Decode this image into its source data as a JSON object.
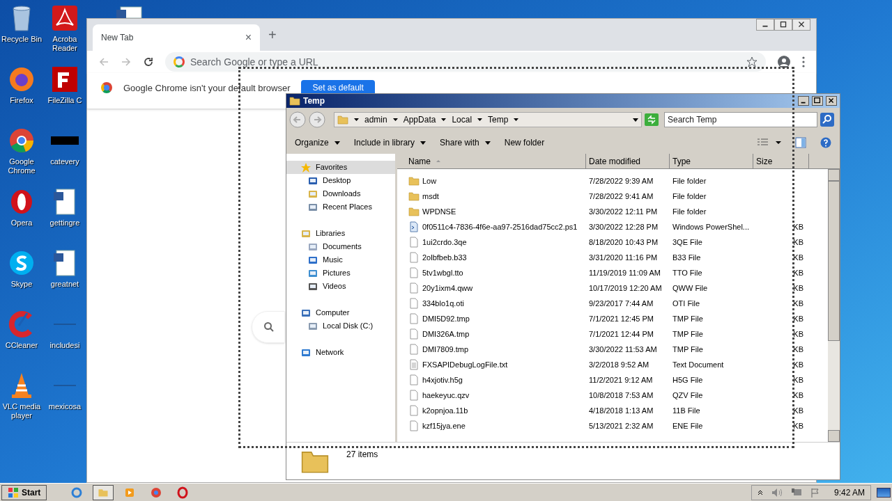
{
  "desktop": {
    "icons": [
      {
        "label": "Recycle Bin"
      },
      {
        "label": "Acroba Reader"
      },
      {
        "label": "Firefox"
      },
      {
        "label": "FileZilla C"
      },
      {
        "label": "Google Chrome"
      },
      {
        "label": "catevery"
      },
      {
        "label": "Opera"
      },
      {
        "label": "gettingre"
      },
      {
        "label": "Skype"
      },
      {
        "label": "greatnet"
      },
      {
        "label": "CCleaner"
      },
      {
        "label": "includesi"
      },
      {
        "label": "VLC media player"
      },
      {
        "label": "mexicosa"
      }
    ]
  },
  "chrome": {
    "tab": {
      "title": "New Tab",
      "close": "×"
    },
    "new_tab": "+",
    "address": {
      "placeholder": "Search Google or type a URL"
    },
    "infobar": {
      "message": "Google Chrome isn't your default browser",
      "button": "Set as default"
    }
  },
  "explorer": {
    "title": "Temp",
    "breadcrumb": [
      "admin",
      "AppData",
      "Local",
      "Temp"
    ],
    "search": {
      "placeholder": "Search Temp"
    },
    "toolbar": [
      {
        "label": "Organize",
        "menu": true
      },
      {
        "label": "Include in library",
        "menu": true
      },
      {
        "label": "Share with",
        "menu": true
      },
      {
        "label": "New folder",
        "menu": false
      }
    ],
    "nav": [
      {
        "label": "Favorites",
        "kind": "star",
        "selected": true,
        "children": [
          {
            "label": "Desktop",
            "kind": "desktop",
            "selected": false
          },
          {
            "label": "Downloads",
            "kind": "downloads",
            "selected": false
          },
          {
            "label": "Recent Places",
            "kind": "recent",
            "selected": false
          }
        ]
      },
      {
        "label": "Libraries",
        "kind": "libraries",
        "selected": false,
        "children": [
          {
            "label": "Documents",
            "kind": "documents",
            "selected": false
          },
          {
            "label": "Music",
            "kind": "music",
            "selected": false
          },
          {
            "label": "Pictures",
            "kind": "pictures",
            "selected": false
          },
          {
            "label": "Videos",
            "kind": "videos",
            "selected": false
          }
        ]
      },
      {
        "label": "Computer",
        "kind": "computer",
        "selected": false,
        "children": [
          {
            "label": "Local Disk (C:)",
            "kind": "disk",
            "selected": false
          }
        ]
      },
      {
        "label": "Network",
        "kind": "network",
        "selected": false
      }
    ],
    "columns": [
      {
        "label": "Name",
        "sorted": true
      },
      {
        "label": "Date modified",
        "sorted": false
      },
      {
        "label": "Type",
        "sorted": false
      },
      {
        "label": "Size",
        "sorted": false
      }
    ],
    "files": [
      {
        "kind": "folder",
        "name": "Low",
        "date": "7/28/2022 9:39 AM",
        "type": "File folder"
      },
      {
        "kind": "folder",
        "name": "msdt",
        "date": "7/28/2022 9:41 AM",
        "type": "File folder"
      },
      {
        "kind": "folder",
        "name": "WPDNSE",
        "date": "3/30/2022 12:11 PM",
        "type": "File folder"
      },
      {
        "kind": "script",
        "name": "0f0511c4-7836-4f6e-aa97-2516dad75cc2.ps1",
        "date": "3/30/2022 12:28 PM",
        "type": "Windows PowerShel...",
        "size": "KB"
      },
      {
        "kind": "file",
        "name": "1ui2crdo.3qe",
        "date": "8/18/2020 10:43 PM",
        "type": "3QE File",
        "size": "KB"
      },
      {
        "kind": "file",
        "name": "2olbfbeb.b33",
        "date": "3/31/2020 11:16 PM",
        "type": "B33 File",
        "size": "KB"
      },
      {
        "kind": "file",
        "name": "5tv1wbgl.tto",
        "date": "11/19/2019 11:09 AM",
        "type": "TTO File",
        "size": "KB"
      },
      {
        "kind": "file",
        "name": "20y1ixm4.qww",
        "date": "10/17/2019 12:20 AM",
        "type": "QWW File",
        "size": "KB"
      },
      {
        "kind": "file",
        "name": "334blo1q.oti",
        "date": "9/23/2017 7:44 AM",
        "type": "OTI File",
        "size": "KB"
      },
      {
        "kind": "file",
        "name": "DMI5D92.tmp",
        "date": "7/1/2021 12:45 PM",
        "type": "TMP File",
        "size": "KB"
      },
      {
        "kind": "file",
        "name": "DMI326A.tmp",
        "date": "7/1/2021 12:44 PM",
        "type": "TMP File",
        "size": "KB"
      },
      {
        "kind": "file",
        "name": "DMI7809.tmp",
        "date": "3/30/2022 11:53 AM",
        "type": "TMP File",
        "size": "KB"
      },
      {
        "kind": "text",
        "name": "FXSAPIDebugLogFile.txt",
        "date": "3/2/2018 9:52 AM",
        "type": "Text Document",
        "size": "KB"
      },
      {
        "kind": "file",
        "name": "h4xjotiv.h5g",
        "date": "11/2/2021 9:12 AM",
        "type": "H5G File",
        "size": "KB"
      },
      {
        "kind": "file",
        "name": "haekeyuc.qzv",
        "date": "10/8/2018 7:53 AM",
        "type": "QZV File",
        "size": "KB"
      },
      {
        "kind": "file",
        "name": "k2opnjoa.11b",
        "date": "4/18/2018 1:13 AM",
        "type": "11B File",
        "size": "KB"
      },
      {
        "kind": "file",
        "name": "kzf15jya.ene",
        "date": "5/13/2021 2:32 AM",
        "type": "ENE File",
        "size": "KB"
      }
    ],
    "status": "27 items"
  },
  "taskbar": {
    "start": "Start",
    "apps": [
      {
        "kind": "ie",
        "selected": false
      },
      {
        "kind": "explorer",
        "selected": true
      },
      {
        "kind": "media",
        "selected": false
      },
      {
        "kind": "chrome",
        "selected": false
      },
      {
        "kind": "opera",
        "selected": false
      }
    ],
    "clock": "9:42 AM"
  }
}
